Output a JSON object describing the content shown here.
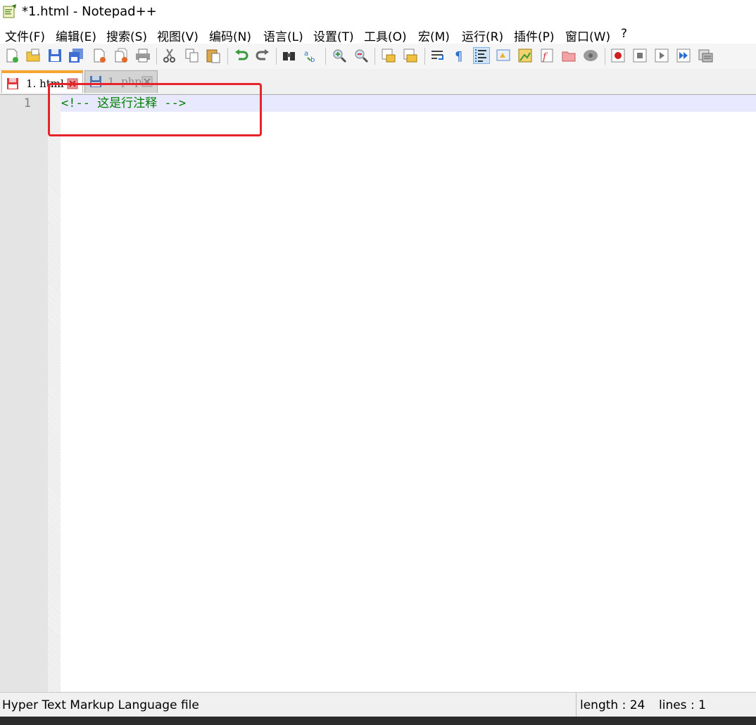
{
  "window": {
    "title": "*1.html - Notepad++"
  },
  "menu": {
    "items": [
      "文件(F)",
      "编辑(E)",
      "搜索(S)",
      "视图(V)",
      "编码(N)",
      "语言(L)",
      "设置(T)",
      "工具(O)",
      "宏(M)",
      "运行(R)",
      "插件(P)",
      "窗口(W)",
      "?"
    ]
  },
  "toolbar": {
    "icons": [
      "new-file-icon",
      "open-file-icon",
      "save-icon",
      "save-all-icon",
      "close-icon",
      "close-all-icon",
      "print-icon",
      "cut-icon",
      "copy-icon",
      "paste-icon",
      "undo-icon",
      "redo-icon",
      "find-icon",
      "replace-icon",
      "zoom-in-icon",
      "zoom-out-icon",
      "sync-vertical-icon",
      "sync-horizontal-icon",
      "word-wrap-icon",
      "show-all-chars-icon",
      "indent-guide-icon",
      "user-language-icon",
      "document-map-icon",
      "function-list-icon",
      "folder-as-workspace-icon",
      "monitoring-icon",
      "record-macro-icon",
      "stop-macro-icon",
      "play-macro-icon",
      "run-macro-multiple-icon",
      "save-macro-icon"
    ]
  },
  "tabs": [
    {
      "label": "1. html",
      "active": true
    },
    {
      "label": "1. php",
      "active": false
    }
  ],
  "editor": {
    "lines": [
      {
        "number": "1",
        "text": "<!-- 这是行注释 -->"
      }
    ],
    "comment_color": "#008000"
  },
  "statusbar": {
    "file_type": "Hyper Text Markup Language file",
    "length": "length : 24",
    "lines": "lines : 1"
  },
  "annotation": {
    "color": "#e8242b"
  }
}
